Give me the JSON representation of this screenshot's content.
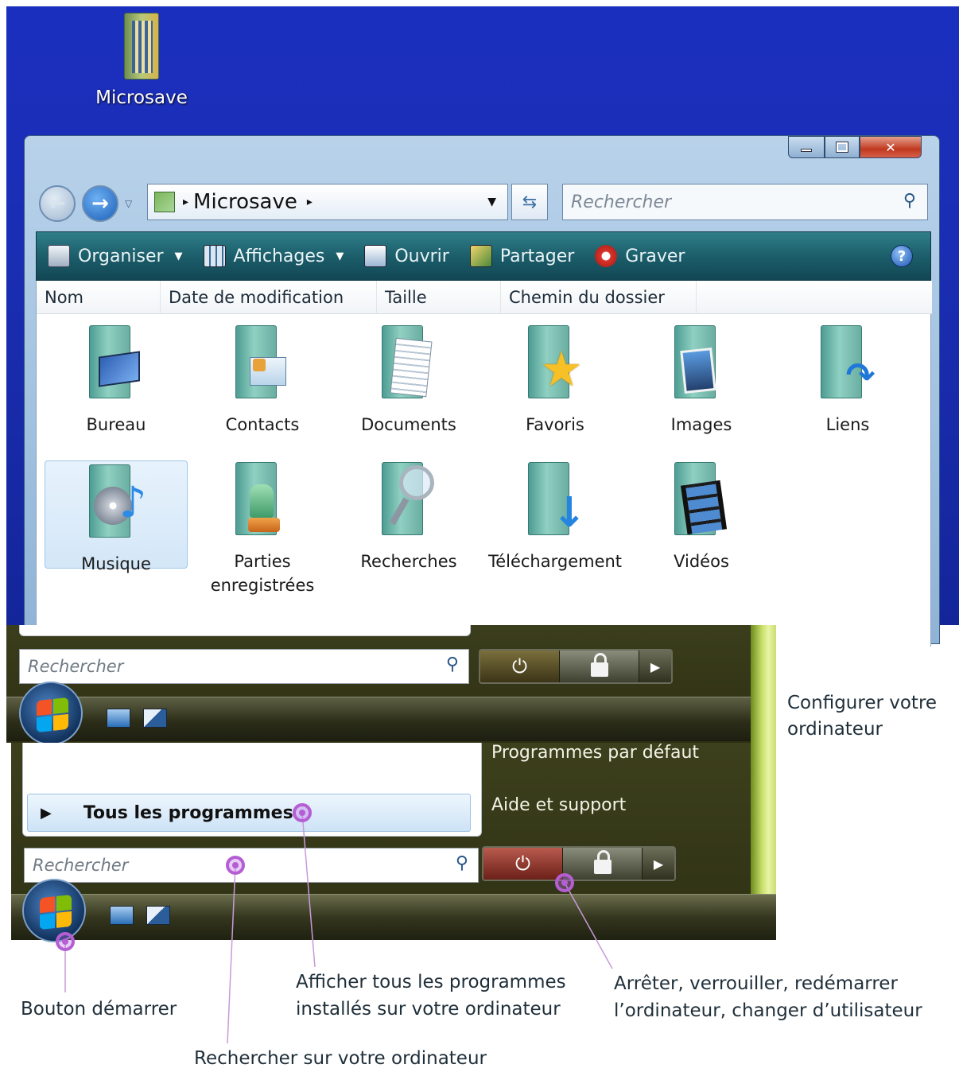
{
  "desktop": {
    "icon_label": "Microsave"
  },
  "window": {
    "address": {
      "folder": "Microsave",
      "separator": "▸"
    },
    "search_placeholder": "Rechercher",
    "toolbar": {
      "organize": "Organiser",
      "views": "Affichages",
      "open": "Ouvrir",
      "share": "Partager",
      "burn": "Graver"
    },
    "columns": [
      "Nom",
      "Date de modification",
      "Taille",
      "Chemin du dossier"
    ],
    "items": [
      {
        "label": "Bureau",
        "icon": "desktop-folder-icon"
      },
      {
        "label": "Contacts",
        "icon": "contacts-folder-icon"
      },
      {
        "label": "Documents",
        "icon": "documents-folder-icon"
      },
      {
        "label": "Favoris",
        "icon": "favorites-folder-icon"
      },
      {
        "label": "Images",
        "icon": "pictures-folder-icon"
      },
      {
        "label": "Liens",
        "icon": "links-folder-icon"
      },
      {
        "label": "Musique",
        "icon": "music-folder-icon",
        "selected": true
      },
      {
        "label": "Parties enregistrées",
        "label_line1": "Parties",
        "label_line2": "enregistrées",
        "icon": "saved-games-folder-icon"
      },
      {
        "label": "Recherches",
        "icon": "searches-folder-icon"
      },
      {
        "label": "Téléchargement",
        "icon": "downloads-folder-icon"
      },
      {
        "label": "Vidéos",
        "icon": "videos-folder-icon"
      }
    ]
  },
  "start_menu_top": {
    "search_placeholder": "Rechercher"
  },
  "start_menu": {
    "right_links": [
      "Programmes par défaut",
      "Aide et support"
    ],
    "all_programs": "Tous les programmes",
    "search_placeholder": "Rechercher"
  },
  "annotations": {
    "configure": {
      "line1": "Configurer votre",
      "line2": "ordinateur"
    },
    "start_button": "Bouton démarrer",
    "all_programs": {
      "line1": "Afficher tous les programmes",
      "line2": "installés sur votre ordinateur"
    },
    "power": {
      "line1": "Arrêter, verrouiller, redémarrer",
      "line2": "l’ordinateur, changer d’utilisateur"
    },
    "search": "Rechercher sur votre ordinateur"
  },
  "colors": {
    "desktop_bg": "#1a2eb3",
    "command_bar": "#1c5e6b",
    "start_menu_bg": "#2e3114",
    "callout_marker": "#b55ed4"
  }
}
